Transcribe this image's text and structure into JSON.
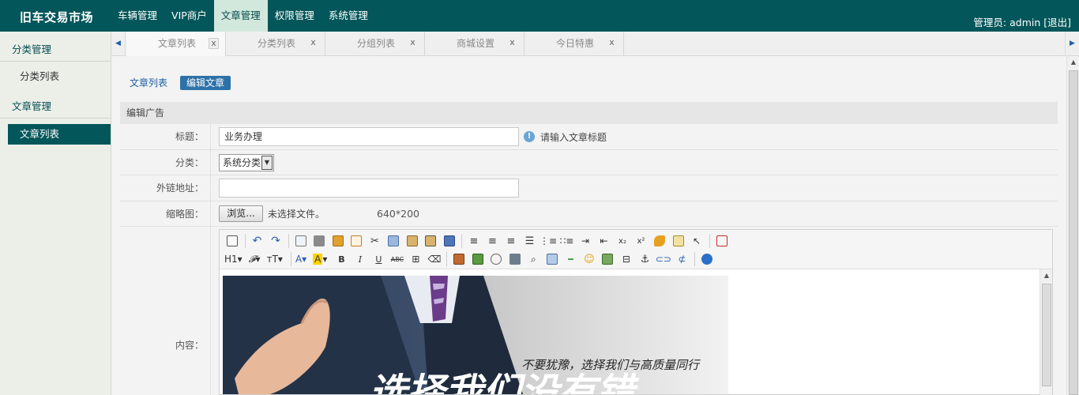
{
  "app": {
    "title": "旧车交易市场"
  },
  "nav": {
    "items": [
      "车辆管理",
      "VIP商户",
      "文章管理",
      "权限管理",
      "系统管理"
    ]
  },
  "admin": {
    "text": "管理员: admin [退出]"
  },
  "sidebar": {
    "group1": "分类管理",
    "item1": "分类列表",
    "group2": "文章管理",
    "item2": "文章列表"
  },
  "tabs": {
    "items": [
      "文章列表",
      "分类列表",
      "分组列表",
      "商城设置",
      "今日特惠"
    ],
    "close": "x"
  },
  "subnav": {
    "list": "文章列表",
    "edit": "编辑文章"
  },
  "form": {
    "section_title": "编辑广告",
    "title_label": "标题：",
    "title_value": "业务办理",
    "title_tip": "请输入文章标题",
    "category_label": "分类：",
    "category_value": "系统分类",
    "link_label": "外链地址：",
    "link_value": "",
    "thumb_label": "缩略图：",
    "browse_label": "浏览...",
    "no_file": "未选择文件。",
    "size_hint": "640*200",
    "content_label": "内容："
  },
  "editor": {
    "heading": "H1",
    "image_caption": "不要犹豫，选择我们与高质量同行",
    "image_slogan": "选择我们没有错"
  },
  "colors": {
    "topbar": "#03565a",
    "nav_active": "#d2e8dc",
    "accent": "#2c72a9"
  }
}
